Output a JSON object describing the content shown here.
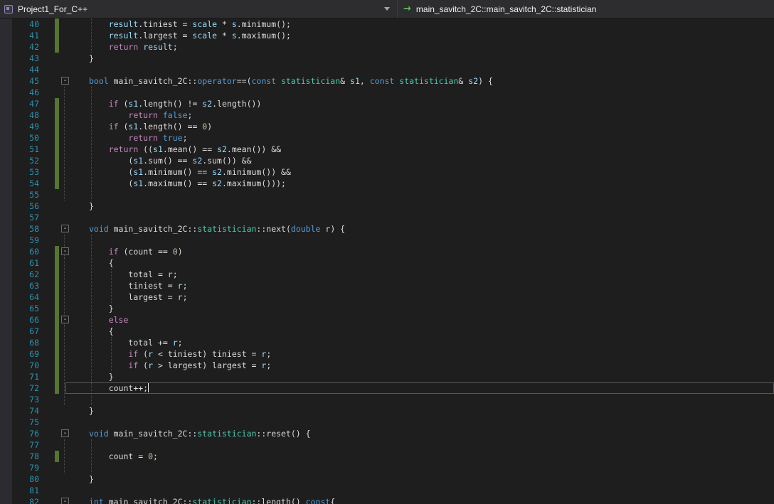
{
  "palette": {
    "bg": "#1e1e1e",
    "nav": "#2d2d30",
    "navtext": "#f1f1f1",
    "glyphmargin": "#2b2b31",
    "linenum": "#2b91af",
    "keyword": "#569cd6",
    "control": "#c586c0",
    "typename": "#4ec9b0",
    "variable": "#9cdcfe",
    "number": "#b5cea8",
    "plain": "#dcdcdc",
    "changebar": "#577430",
    "guide": "#4b4b55",
    "curlineborder": "#56565c",
    "arrowgreen": "#5fbb63"
  },
  "navbar": {
    "project_label": "Project1_For_C++",
    "member_label": "main_savitch_2C::main_savitch_2C::statistician",
    "member_icon_glyph": "→"
  },
  "editor": {
    "current_line": 72,
    "fold_glyph": "-",
    "lines": [
      {
        "n": 40,
        "chg": true,
        "seg": [
          [
            "    ",
            "p"
          ],
          [
            "result",
            "v"
          ],
          [
            ".tiniest = ",
            "p"
          ],
          [
            "scale",
            "v"
          ],
          [
            " * ",
            "p"
          ],
          [
            "s",
            "v"
          ],
          [
            ".minimum();",
            "p"
          ]
        ]
      },
      {
        "n": 41,
        "chg": true,
        "seg": [
          [
            "    ",
            "p"
          ],
          [
            "result",
            "v"
          ],
          [
            ".largest = ",
            "p"
          ],
          [
            "scale",
            "v"
          ],
          [
            " * ",
            "p"
          ],
          [
            "s",
            "v"
          ],
          [
            ".maximum();",
            "p"
          ]
        ]
      },
      {
        "n": 42,
        "chg": true,
        "seg": [
          [
            "    ",
            "p"
          ],
          [
            "return",
            "c"
          ],
          [
            " ",
            "p"
          ],
          [
            "result",
            "v"
          ],
          [
            ";",
            "p"
          ]
        ]
      },
      {
        "n": 43,
        "seg": [
          [
            "}",
            "p"
          ]
        ]
      },
      {
        "n": 44,
        "seg": []
      },
      {
        "n": 45,
        "fold": true,
        "seg": [
          [
            "bool",
            "k"
          ],
          [
            " main_savitch_2C::",
            "p"
          ],
          [
            "operator",
            "k"
          ],
          [
            "==(",
            "p"
          ],
          [
            "const",
            "k"
          ],
          [
            " ",
            "p"
          ],
          [
            "statistician",
            "t"
          ],
          [
            "& ",
            "p"
          ],
          [
            "s1",
            "v"
          ],
          [
            ", ",
            "p"
          ],
          [
            "const",
            "k"
          ],
          [
            " ",
            "p"
          ],
          [
            "statistician",
            "t"
          ],
          [
            "& ",
            "p"
          ],
          [
            "s2",
            "v"
          ],
          [
            ") {",
            "p"
          ]
        ]
      },
      {
        "n": 46,
        "seg": []
      },
      {
        "n": 47,
        "chg": true,
        "seg": [
          [
            "    ",
            "p"
          ],
          [
            "if",
            "c"
          ],
          [
            " (",
            "p"
          ],
          [
            "s1",
            "v"
          ],
          [
            ".length() != ",
            "p"
          ],
          [
            "s2",
            "v"
          ],
          [
            ".length())",
            "p"
          ]
        ]
      },
      {
        "n": 48,
        "chg": true,
        "seg": [
          [
            "        ",
            "p"
          ],
          [
            "return",
            "c"
          ],
          [
            " ",
            "p"
          ],
          [
            "false",
            "k"
          ],
          [
            ";",
            "p"
          ]
        ]
      },
      {
        "n": 49,
        "chg": true,
        "seg": [
          [
            "    ",
            "p"
          ],
          [
            "if",
            "c"
          ],
          [
            " (",
            "p"
          ],
          [
            "s1",
            "v"
          ],
          [
            ".length() == ",
            "p"
          ],
          [
            "0",
            "n"
          ],
          [
            ")",
            "p"
          ]
        ]
      },
      {
        "n": 50,
        "chg": true,
        "seg": [
          [
            "        ",
            "p"
          ],
          [
            "return",
            "c"
          ],
          [
            " ",
            "p"
          ],
          [
            "true",
            "k"
          ],
          [
            ";",
            "p"
          ]
        ]
      },
      {
        "n": 51,
        "chg": true,
        "seg": [
          [
            "    ",
            "p"
          ],
          [
            "return",
            "c"
          ],
          [
            " ((",
            "p"
          ],
          [
            "s1",
            "v"
          ],
          [
            ".mean() == ",
            "p"
          ],
          [
            "s2",
            "v"
          ],
          [
            ".mean()) &&",
            "p"
          ]
        ]
      },
      {
        "n": 52,
        "chg": true,
        "seg": [
          [
            "        (",
            "p"
          ],
          [
            "s1",
            "v"
          ],
          [
            ".sum() == ",
            "p"
          ],
          [
            "s2",
            "v"
          ],
          [
            ".sum()) &&",
            "p"
          ]
        ]
      },
      {
        "n": 53,
        "chg": true,
        "seg": [
          [
            "        (",
            "p"
          ],
          [
            "s1",
            "v"
          ],
          [
            ".minimum() == ",
            "p"
          ],
          [
            "s2",
            "v"
          ],
          [
            ".minimum()) &&",
            "p"
          ]
        ]
      },
      {
        "n": 54,
        "chg": true,
        "seg": [
          [
            "        (",
            "p"
          ],
          [
            "s1",
            "v"
          ],
          [
            ".maximum() == ",
            "p"
          ],
          [
            "s2",
            "v"
          ],
          [
            ".maximum()));",
            "p"
          ]
        ]
      },
      {
        "n": 55,
        "seg": []
      },
      {
        "n": 56,
        "seg": [
          [
            "}",
            "p"
          ]
        ]
      },
      {
        "n": 57,
        "seg": []
      },
      {
        "n": 58,
        "fold": true,
        "seg": [
          [
            "void",
            "k"
          ],
          [
            " main_savitch_2C::",
            "p"
          ],
          [
            "statistician",
            "t"
          ],
          [
            "::next(",
            "p"
          ],
          [
            "double",
            "k"
          ],
          [
            " ",
            "p"
          ],
          [
            "r",
            "v"
          ],
          [
            ") {",
            "p"
          ]
        ]
      },
      {
        "n": 59,
        "seg": []
      },
      {
        "n": 60,
        "chg": true,
        "fold": true,
        "seg": [
          [
            "    ",
            "p"
          ],
          [
            "if",
            "c"
          ],
          [
            " (",
            "p"
          ],
          [
            "count",
            "p"
          ],
          [
            " == ",
            "p"
          ],
          [
            "0",
            "n"
          ],
          [
            ")",
            "p"
          ]
        ]
      },
      {
        "n": 61,
        "chg": true,
        "seg": [
          [
            "    {",
            "p"
          ]
        ]
      },
      {
        "n": 62,
        "chg": true,
        "seg": [
          [
            "        ",
            "p"
          ],
          [
            "total",
            "p"
          ],
          [
            " = ",
            "p"
          ],
          [
            "r",
            "v"
          ],
          [
            ";",
            "p"
          ]
        ]
      },
      {
        "n": 63,
        "chg": true,
        "seg": [
          [
            "        ",
            "p"
          ],
          [
            "tiniest",
            "p"
          ],
          [
            " = ",
            "p"
          ],
          [
            "r",
            "v"
          ],
          [
            ";",
            "p"
          ]
        ]
      },
      {
        "n": 64,
        "chg": true,
        "seg": [
          [
            "        ",
            "p"
          ],
          [
            "largest",
            "p"
          ],
          [
            " = ",
            "p"
          ],
          [
            "r",
            "v"
          ],
          [
            ";",
            "p"
          ]
        ]
      },
      {
        "n": 65,
        "chg": true,
        "seg": [
          [
            "    }",
            "p"
          ]
        ]
      },
      {
        "n": 66,
        "chg": true,
        "fold": true,
        "seg": [
          [
            "    ",
            "p"
          ],
          [
            "else",
            "c"
          ]
        ]
      },
      {
        "n": 67,
        "chg": true,
        "seg": [
          [
            "    {",
            "p"
          ]
        ]
      },
      {
        "n": 68,
        "chg": true,
        "seg": [
          [
            "        ",
            "p"
          ],
          [
            "total",
            "p"
          ],
          [
            " += ",
            "p"
          ],
          [
            "r",
            "v"
          ],
          [
            ";",
            "p"
          ]
        ]
      },
      {
        "n": 69,
        "chg": true,
        "seg": [
          [
            "        ",
            "p"
          ],
          [
            "if",
            "c"
          ],
          [
            " (",
            "p"
          ],
          [
            "r",
            "v"
          ],
          [
            " < ",
            "p"
          ],
          [
            "tiniest",
            "p"
          ],
          [
            ") ",
            "p"
          ],
          [
            "tiniest",
            "p"
          ],
          [
            " = ",
            "p"
          ],
          [
            "r",
            "v"
          ],
          [
            ";",
            "p"
          ]
        ]
      },
      {
        "n": 70,
        "chg": true,
        "seg": [
          [
            "        ",
            "p"
          ],
          [
            "if",
            "c"
          ],
          [
            " (",
            "p"
          ],
          [
            "r",
            "v"
          ],
          [
            " > ",
            "p"
          ],
          [
            "largest",
            "p"
          ],
          [
            ") ",
            "p"
          ],
          [
            "largest",
            "p"
          ],
          [
            " = ",
            "p"
          ],
          [
            "r",
            "v"
          ],
          [
            ";",
            "p"
          ]
        ]
      },
      {
        "n": 71,
        "chg": true,
        "seg": [
          [
            "    }",
            "p"
          ]
        ]
      },
      {
        "n": 72,
        "chg": true,
        "caret": true,
        "seg": [
          [
            "    ",
            "p"
          ],
          [
            "count",
            "p"
          ],
          [
            "++;",
            "p"
          ]
        ]
      },
      {
        "n": 73,
        "seg": []
      },
      {
        "n": 74,
        "seg": [
          [
            "}",
            "p"
          ]
        ]
      },
      {
        "n": 75,
        "seg": []
      },
      {
        "n": 76,
        "fold": true,
        "seg": [
          [
            "void",
            "k"
          ],
          [
            " main_savitch_2C::",
            "p"
          ],
          [
            "statistician",
            "t"
          ],
          [
            "::reset() {",
            "p"
          ]
        ]
      },
      {
        "n": 77,
        "seg": []
      },
      {
        "n": 78,
        "chg": true,
        "seg": [
          [
            "    ",
            "p"
          ],
          [
            "count",
            "p"
          ],
          [
            " = ",
            "p"
          ],
          [
            "0",
            "n"
          ],
          [
            ";",
            "p"
          ]
        ]
      },
      {
        "n": 79,
        "seg": []
      },
      {
        "n": 80,
        "seg": [
          [
            "}",
            "p"
          ]
        ]
      },
      {
        "n": 81,
        "seg": []
      },
      {
        "n": 82,
        "fold": true,
        "seg": [
          [
            "int",
            "k"
          ],
          [
            " main_savitch_2C::",
            "p"
          ],
          [
            "statistician",
            "t"
          ],
          [
            "::length() ",
            "p"
          ],
          [
            "const",
            "k"
          ],
          [
            "{",
            "p"
          ]
        ]
      }
    ],
    "guides": {
      "margin": [
        [
          46,
          55
        ],
        [
          59,
          73
        ],
        [
          61,
          64
        ],
        [
          67,
          70
        ],
        [
          77,
          79
        ]
      ],
      "indent1": [
        [
          40,
          42
        ],
        [
          46,
          55
        ],
        [
          59,
          73
        ],
        [
          77,
          79
        ]
      ],
      "indent2": [
        [
          62,
          64
        ],
        [
          68,
          70
        ]
      ]
    }
  }
}
